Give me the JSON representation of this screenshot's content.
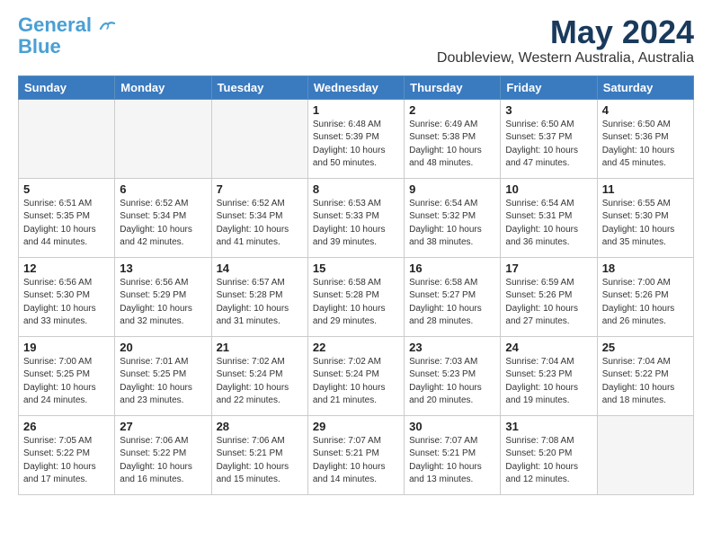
{
  "logo": {
    "line1": "General",
    "line2": "Blue"
  },
  "title": "May 2024",
  "location": "Doubleview, Western Australia, Australia",
  "days_of_week": [
    "Sunday",
    "Monday",
    "Tuesday",
    "Wednesday",
    "Thursday",
    "Friday",
    "Saturday"
  ],
  "weeks": [
    [
      {
        "day": "",
        "info": ""
      },
      {
        "day": "",
        "info": ""
      },
      {
        "day": "",
        "info": ""
      },
      {
        "day": "1",
        "info": "Sunrise: 6:48 AM\nSunset: 5:39 PM\nDaylight: 10 hours\nand 50 minutes."
      },
      {
        "day": "2",
        "info": "Sunrise: 6:49 AM\nSunset: 5:38 PM\nDaylight: 10 hours\nand 48 minutes."
      },
      {
        "day": "3",
        "info": "Sunrise: 6:50 AM\nSunset: 5:37 PM\nDaylight: 10 hours\nand 47 minutes."
      },
      {
        "day": "4",
        "info": "Sunrise: 6:50 AM\nSunset: 5:36 PM\nDaylight: 10 hours\nand 45 minutes."
      }
    ],
    [
      {
        "day": "5",
        "info": "Sunrise: 6:51 AM\nSunset: 5:35 PM\nDaylight: 10 hours\nand 44 minutes."
      },
      {
        "day": "6",
        "info": "Sunrise: 6:52 AM\nSunset: 5:34 PM\nDaylight: 10 hours\nand 42 minutes."
      },
      {
        "day": "7",
        "info": "Sunrise: 6:52 AM\nSunset: 5:34 PM\nDaylight: 10 hours\nand 41 minutes."
      },
      {
        "day": "8",
        "info": "Sunrise: 6:53 AM\nSunset: 5:33 PM\nDaylight: 10 hours\nand 39 minutes."
      },
      {
        "day": "9",
        "info": "Sunrise: 6:54 AM\nSunset: 5:32 PM\nDaylight: 10 hours\nand 38 minutes."
      },
      {
        "day": "10",
        "info": "Sunrise: 6:54 AM\nSunset: 5:31 PM\nDaylight: 10 hours\nand 36 minutes."
      },
      {
        "day": "11",
        "info": "Sunrise: 6:55 AM\nSunset: 5:30 PM\nDaylight: 10 hours\nand 35 minutes."
      }
    ],
    [
      {
        "day": "12",
        "info": "Sunrise: 6:56 AM\nSunset: 5:30 PM\nDaylight: 10 hours\nand 33 minutes."
      },
      {
        "day": "13",
        "info": "Sunrise: 6:56 AM\nSunset: 5:29 PM\nDaylight: 10 hours\nand 32 minutes."
      },
      {
        "day": "14",
        "info": "Sunrise: 6:57 AM\nSunset: 5:28 PM\nDaylight: 10 hours\nand 31 minutes."
      },
      {
        "day": "15",
        "info": "Sunrise: 6:58 AM\nSunset: 5:28 PM\nDaylight: 10 hours\nand 29 minutes."
      },
      {
        "day": "16",
        "info": "Sunrise: 6:58 AM\nSunset: 5:27 PM\nDaylight: 10 hours\nand 28 minutes."
      },
      {
        "day": "17",
        "info": "Sunrise: 6:59 AM\nSunset: 5:26 PM\nDaylight: 10 hours\nand 27 minutes."
      },
      {
        "day": "18",
        "info": "Sunrise: 7:00 AM\nSunset: 5:26 PM\nDaylight: 10 hours\nand 26 minutes."
      }
    ],
    [
      {
        "day": "19",
        "info": "Sunrise: 7:00 AM\nSunset: 5:25 PM\nDaylight: 10 hours\nand 24 minutes."
      },
      {
        "day": "20",
        "info": "Sunrise: 7:01 AM\nSunset: 5:25 PM\nDaylight: 10 hours\nand 23 minutes."
      },
      {
        "day": "21",
        "info": "Sunrise: 7:02 AM\nSunset: 5:24 PM\nDaylight: 10 hours\nand 22 minutes."
      },
      {
        "day": "22",
        "info": "Sunrise: 7:02 AM\nSunset: 5:24 PM\nDaylight: 10 hours\nand 21 minutes."
      },
      {
        "day": "23",
        "info": "Sunrise: 7:03 AM\nSunset: 5:23 PM\nDaylight: 10 hours\nand 20 minutes."
      },
      {
        "day": "24",
        "info": "Sunrise: 7:04 AM\nSunset: 5:23 PM\nDaylight: 10 hours\nand 19 minutes."
      },
      {
        "day": "25",
        "info": "Sunrise: 7:04 AM\nSunset: 5:22 PM\nDaylight: 10 hours\nand 18 minutes."
      }
    ],
    [
      {
        "day": "26",
        "info": "Sunrise: 7:05 AM\nSunset: 5:22 PM\nDaylight: 10 hours\nand 17 minutes."
      },
      {
        "day": "27",
        "info": "Sunrise: 7:06 AM\nSunset: 5:22 PM\nDaylight: 10 hours\nand 16 minutes."
      },
      {
        "day": "28",
        "info": "Sunrise: 7:06 AM\nSunset: 5:21 PM\nDaylight: 10 hours\nand 15 minutes."
      },
      {
        "day": "29",
        "info": "Sunrise: 7:07 AM\nSunset: 5:21 PM\nDaylight: 10 hours\nand 14 minutes."
      },
      {
        "day": "30",
        "info": "Sunrise: 7:07 AM\nSunset: 5:21 PM\nDaylight: 10 hours\nand 13 minutes."
      },
      {
        "day": "31",
        "info": "Sunrise: 7:08 AM\nSunset: 5:20 PM\nDaylight: 10 hours\nand 12 minutes."
      },
      {
        "day": "",
        "info": ""
      }
    ]
  ]
}
